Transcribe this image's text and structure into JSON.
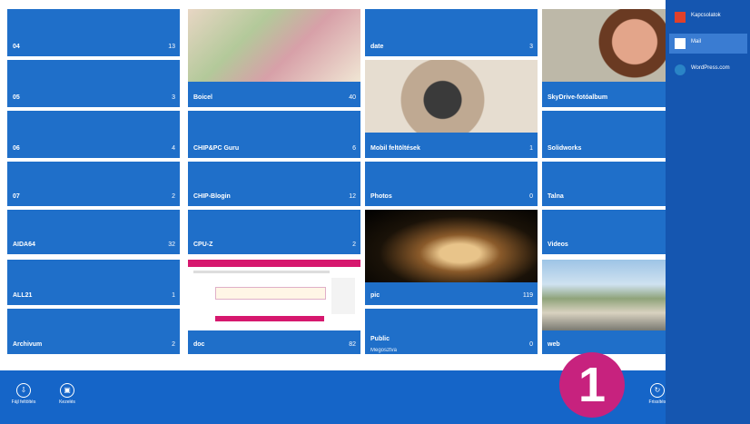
{
  "folders": [
    {
      "name": "04",
      "count": "13"
    },
    {
      "name": "05",
      "count": "3"
    },
    {
      "name": "06",
      "count": "4"
    },
    {
      "name": "07",
      "count": "2"
    },
    {
      "name": "AIDA64",
      "count": "32"
    },
    {
      "name": "ALL21",
      "count": "1"
    },
    {
      "name": "Archivum",
      "count": "2"
    },
    {
      "name": "Boicel",
      "count": "40"
    },
    {
      "name": "CHIP&PC Guru",
      "count": "6"
    },
    {
      "name": "CHIP-Blogin",
      "count": "12"
    },
    {
      "name": "CPU-Z",
      "count": "2"
    },
    {
      "name": "doc",
      "count": "82"
    },
    {
      "name": "date",
      "count": "3"
    },
    {
      "name": "Mobil feltöltések",
      "count": "1"
    },
    {
      "name": "Photos",
      "count": "0"
    },
    {
      "name": "pic",
      "count": "119"
    },
    {
      "name": "Public",
      "sub": "Megosztva",
      "count": "0"
    },
    {
      "name": "SkyDrive-fotóalbum",
      "count": ""
    },
    {
      "name": "Solidworks",
      "count": ""
    },
    {
      "name": "Talna",
      "count": ""
    },
    {
      "name": "Videos",
      "count": ""
    },
    {
      "name": "web",
      "count": ""
    }
  ],
  "appbar": {
    "btn1": "Fájl feltöltés",
    "btn2": "Kezelés",
    "btn3": "Frissítés"
  },
  "share": {
    "items": [
      {
        "label": "Kapcsolatok"
      },
      {
        "label": "Mail"
      },
      {
        "label": "WordPress.com"
      }
    ]
  },
  "badge": "1",
  "colors": {
    "tile": "#1f6fc9",
    "charm": "#1556b0",
    "badge": "#c7227e"
  }
}
